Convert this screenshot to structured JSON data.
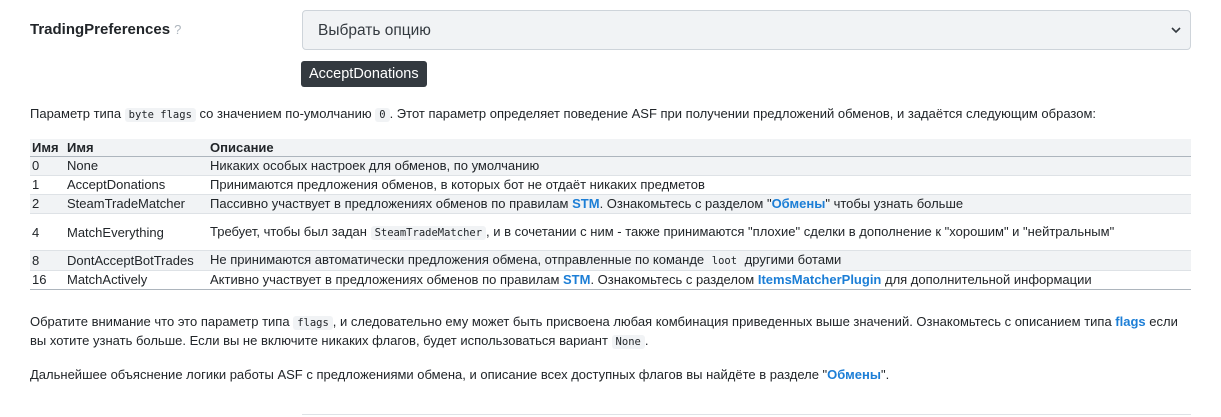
{
  "field": {
    "label": "TradingPreferences",
    "help": "?",
    "select_value": "Выбрать опцию",
    "selected_chip": "AcceptDonations"
  },
  "intro": {
    "t1": "Параметр типа ",
    "code1": "byte flags",
    "t2": " со значением по-умолчанию ",
    "code2": "0",
    "t3": ". Этот параметр определяет поведение ASF при получении предложений обменов, и задаётся следующим образом:"
  },
  "table": {
    "headers": [
      "Имя",
      "Имя",
      "Описание"
    ],
    "rows": [
      {
        "value": "0",
        "name": "None",
        "desc": "Никаких особых настроек для обменов, по умолчанию"
      },
      {
        "value": "1",
        "name": "AcceptDonations",
        "desc": "Принимаются предложения обменов, в которых бот не отдаёт никаких предметов"
      },
      {
        "value": "2",
        "name": "SteamTradeMatcher",
        "d1": "Пассивно участвует в предложениях обменов по правилам ",
        "link1": "STM",
        "d2": ". Ознакомьтесь с разделом \"",
        "link2": "Обмены",
        "d3": "\" чтобы узнать больше"
      },
      {
        "value": "4",
        "name": "MatchEverything",
        "d1": "Требует, чтобы был задан ",
        "code": "SteamTradeMatcher",
        "d2": ", и в сочетании с ним - также принимаются \"плохие\" сделки в дополнение к \"хорошим\" и \"нейтральным\""
      },
      {
        "value": "8",
        "name": "DontAcceptBotTrades",
        "d1": "Не принимаются автоматически предложения обмена, отправленные по команде ",
        "code": "loot",
        "d2": " другими ботами"
      },
      {
        "value": "16",
        "name": "MatchActively",
        "d1": "Активно участвует в предложениях обменов по правилам ",
        "link1": "STM",
        "d2": ". Ознакомьтесь с разделом ",
        "link2": "ItemsMatcherPlugin",
        "d3": " для дополнительной информации"
      }
    ]
  },
  "note": {
    "t1": "Обратите внимание что это параметр типа ",
    "code1": "flags",
    "t2": ", и следовательно ему может быть присвоена любая комбинация приведенных выше значений. Ознакомьтесь с описанием типа ",
    "link1": "flags",
    "t3": " если вы хотите узнать больше. Если вы не включите никаких флагов, будет использоваться вариант ",
    "code2": "None",
    "t4": "."
  },
  "footer": {
    "t1": "Дальнейшее объяснение логики работы ASF с предложениями обмена, и описание всех доступных флагов вы найдёте в разделе \"",
    "link1": "Обмены",
    "t2": "\"."
  }
}
